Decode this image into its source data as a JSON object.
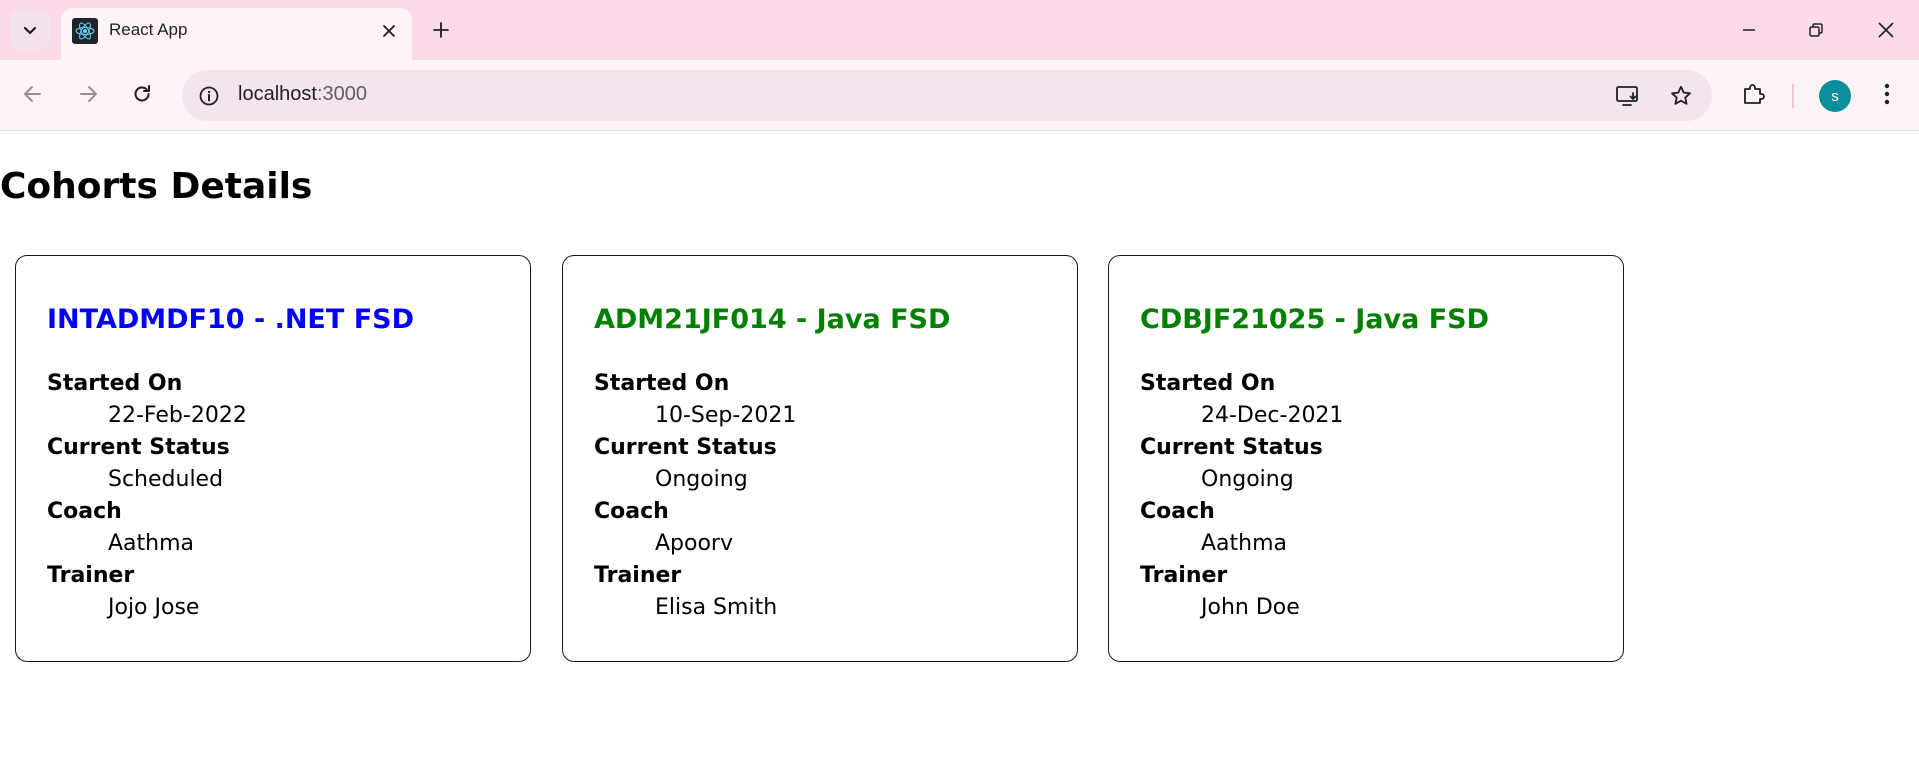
{
  "browser": {
    "tab_title": "React App",
    "url_host": "localhost",
    "url_port": ":3000",
    "avatar_letter": "s"
  },
  "page": {
    "title": "Cohorts Details"
  },
  "labels": {
    "started_on": "Started On",
    "current_status": "Current Status",
    "coach": "Coach",
    "trainer": "Trainer"
  },
  "cohorts": [
    {
      "title": "INTADMDF10 - .NET FSD",
      "title_color": "#0000ff",
      "started_on": "22-Feb-2022",
      "current_status": "Scheduled",
      "coach": "Aathma",
      "trainer": "Jojo Jose"
    },
    {
      "title": "ADM21JF014 - Java FSD",
      "title_color": "#008000",
      "started_on": "10-Sep-2021",
      "current_status": "Ongoing",
      "coach": "Apoorv",
      "trainer": "Elisa Smith"
    },
    {
      "title": "CDBJF21025 - Java FSD",
      "title_color": "#008000",
      "started_on": "24-Dec-2021",
      "current_status": "Ongoing",
      "coach": "Aathma",
      "trainer": "John Doe"
    }
  ]
}
